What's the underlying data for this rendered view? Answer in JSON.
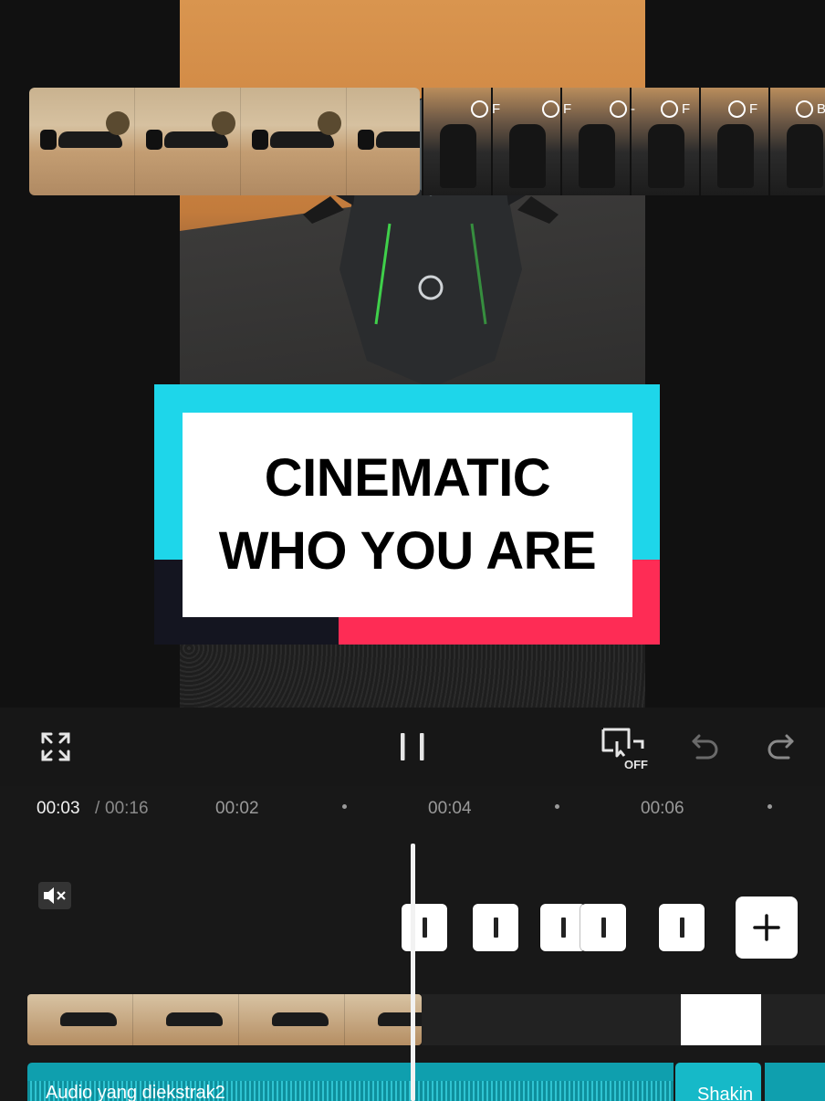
{
  "preview": {
    "title_lines": [
      "CINEMATIC",
      "WHO YOU ARE"
    ],
    "colors": {
      "cyan": "#1ed6ea",
      "pink": "#fe2c55",
      "dark": "#141520"
    }
  },
  "toolbar": {
    "fullscreen_icon": "fullscreen-icon",
    "pause_icon": "pause-icon",
    "keyframe_off_label": "OFF",
    "undo_icon": "undo-icon",
    "redo_icon": "redo-icon"
  },
  "timeline": {
    "current_time": "00:03",
    "separator": "/",
    "total_time": "00:16",
    "ruler_ticks": [
      "00:02",
      "00:04",
      "00:06"
    ],
    "segment_labels": [
      "F",
      "F",
      "-",
      "F",
      "F",
      "B"
    ],
    "audio_main_label": "Audio yang diekstrak2",
    "audio_second_label": "Shakin",
    "add_icon": "plus-icon"
  }
}
